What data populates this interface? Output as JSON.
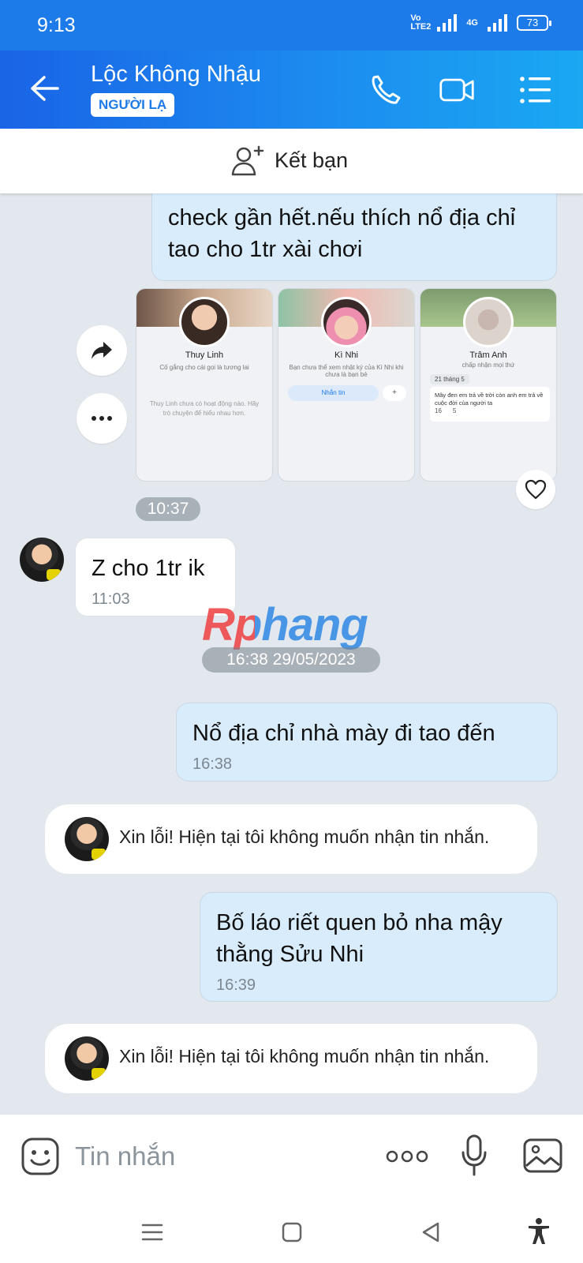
{
  "status_bar": {
    "time": "9:13",
    "volte": "Vo LTE2",
    "network": "4G",
    "battery": "73"
  },
  "header": {
    "contact_name": "Lộc Không Nhậu",
    "badge": "NGƯỜI LẠ"
  },
  "add_friend": {
    "label": "Kết bạn"
  },
  "messages": {
    "partial_top": "check gần hết.nếu thích nổ địa chỉ tao cho 1tr xài chơi",
    "shared_time": "10:37",
    "incoming_1": {
      "text": "Z cho 1tr ik",
      "time": "11:03"
    },
    "date_separator": "16:38 29/05/2023",
    "outgoing_1": {
      "text": "Nổ địa chỉ nhà mày đi tao đến",
      "time": "16:38"
    },
    "system_1": "Xin lỗi! Hiện tại tôi không muốn nhận tin nhắn.",
    "outgoing_2": {
      "line1": "Bố láo riết quen bỏ nha mậy",
      "line2": "thằng Sửu Nhi",
      "time": "16:39"
    },
    "system_2": "Xin lỗi! Hiện tại tôi không muốn nhận tin nhắn."
  },
  "profile_cards": [
    {
      "name": "Thuy Linh",
      "status": "Cố gắng cho cái gọi là tương lai",
      "note": "Thuy Linh chưa có hoạt động nào. Hãy trò chuyện để hiểu nhau hơn."
    },
    {
      "name": "Kì Nhi",
      "status": "Bạn chưa thể xem nhật ký của Kì Nhi khi chưa là bạn bè",
      "button": "Nhắn tin"
    },
    {
      "name": "Trâm Anh",
      "status": "chấp nhận mọi thứ",
      "date": "21 tháng 5",
      "post": "Mây đen em trả về trời còn anh em trả về cuộc đời của người ta",
      "likes": "16",
      "comments": "5"
    }
  ],
  "watermark": "Rphang",
  "composer": {
    "placeholder": "Tin nhắn"
  }
}
